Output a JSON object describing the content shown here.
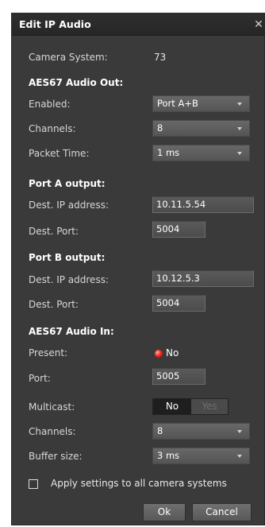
{
  "dialog": {
    "title": "Edit IP Audio",
    "close_icon": "close-icon"
  },
  "camera_system": {
    "label": "Camera System:",
    "value": "73"
  },
  "aes67_out": {
    "heading": "AES67 Audio Out:",
    "enabled": {
      "label": "Enabled:",
      "value": "Port A+B"
    },
    "channels": {
      "label": "Channels:",
      "value": "8"
    },
    "packet_time": {
      "label": "Packet Time:",
      "value": "1 ms"
    }
  },
  "port_a": {
    "heading": "Port A output:",
    "ip": {
      "label": "Dest. IP address:",
      "value": "10.11.5.54"
    },
    "port": {
      "label": "Dest. Port:",
      "value": "5004"
    }
  },
  "port_b": {
    "heading": "Port B output:",
    "ip": {
      "label": "Dest. IP address:",
      "value": "10.12.5.3"
    },
    "port": {
      "label": "Dest. Port:",
      "value": "5004"
    }
  },
  "aes67_in": {
    "heading": "AES67 Audio In:",
    "present": {
      "label": "Present:",
      "value": "No",
      "indicator_color": "#f02a20"
    },
    "port": {
      "label": "Port:",
      "value": "5005"
    },
    "multicast": {
      "label": "Multicast:",
      "options": [
        "No",
        "Yes"
      ],
      "selected": "No"
    },
    "channels": {
      "label": "Channels:",
      "value": "8"
    },
    "buffer_size": {
      "label": "Buffer size:",
      "value": "3 ms"
    }
  },
  "apply_all": {
    "label": "Apply settings to all camera systems",
    "checked": false
  },
  "buttons": {
    "ok": "Ok",
    "cancel": "Cancel"
  }
}
